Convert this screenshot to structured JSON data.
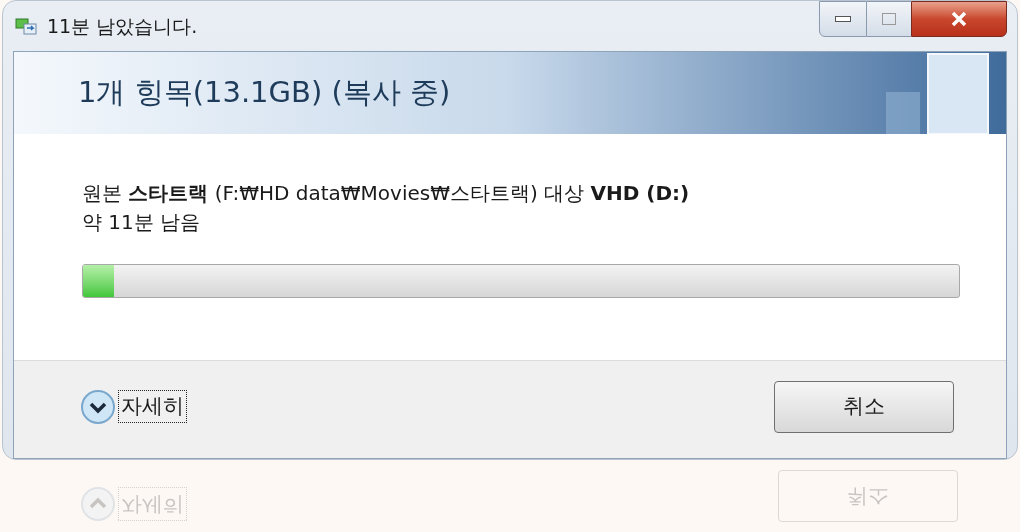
{
  "window": {
    "title": "11분 남았습니다."
  },
  "header": {
    "title": "1개 힝목(13.1GB) (복사 중)"
  },
  "body": {
    "source_line": "원본 **스타트랙** (F:₩HD data₩Movies₩스타트랙) 대상 **VHD (D:)**",
    "time_left": "약 11분 남음",
    "progress": {
      "level": 0.035
    }
  },
  "footer": {
    "details": {
      "label": "자세히",
      "expanded": false
    },
    "cancel": "취소"
  },
  "reflection": {
    "details": "자세히",
    "cancel": "취소"
  }
}
